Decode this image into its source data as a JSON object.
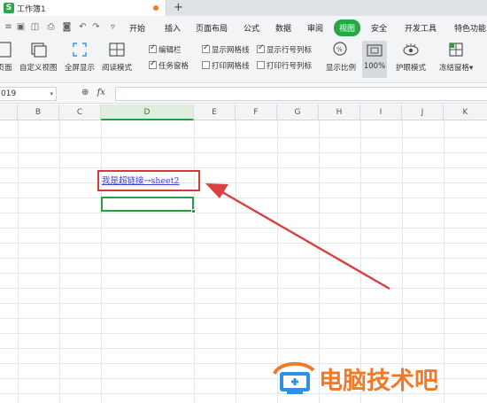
{
  "tab": {
    "title": "工作簿1",
    "logo": "S"
  },
  "menu": {
    "items": [
      "开始",
      "插入",
      "页面布局",
      "公式",
      "数据",
      "审阅",
      "视图",
      "安全",
      "开发工具",
      "特色功能"
    ],
    "active": "视图"
  },
  "ribbon": {
    "page_view": "页面",
    "custom_view": "自定义视图",
    "fullscreen": "全屏显示",
    "reading_mode": "阅读模式",
    "checks": {
      "edit_bar": "编辑栏",
      "task_pane": "任务窗格",
      "show_gridlines": "显示网格线",
      "print_gridlines": "打印网格线",
      "show_headers": "显示行号列标",
      "print_headers": "打印行号列标"
    },
    "zoom_label": "显示比例",
    "zoom_value": "100%",
    "eye_mode": "护眼模式",
    "freeze": "冻结窗格"
  },
  "formula_bar": {
    "name_box": "019",
    "fx": "fx",
    "content": ""
  },
  "columns": [
    "B",
    "C",
    "D",
    "E",
    "F",
    "G",
    "H",
    "I",
    "J",
    "K"
  ],
  "selected_column": "D",
  "cells": {
    "link_text": "我是超链接→sheet2"
  },
  "watermark": {
    "text": "电脑技术吧"
  },
  "colors": {
    "accent": "#27a844",
    "highlight": "#d13b3b",
    "link": "#3b3bd6",
    "watermark": "#ef7b2a"
  }
}
